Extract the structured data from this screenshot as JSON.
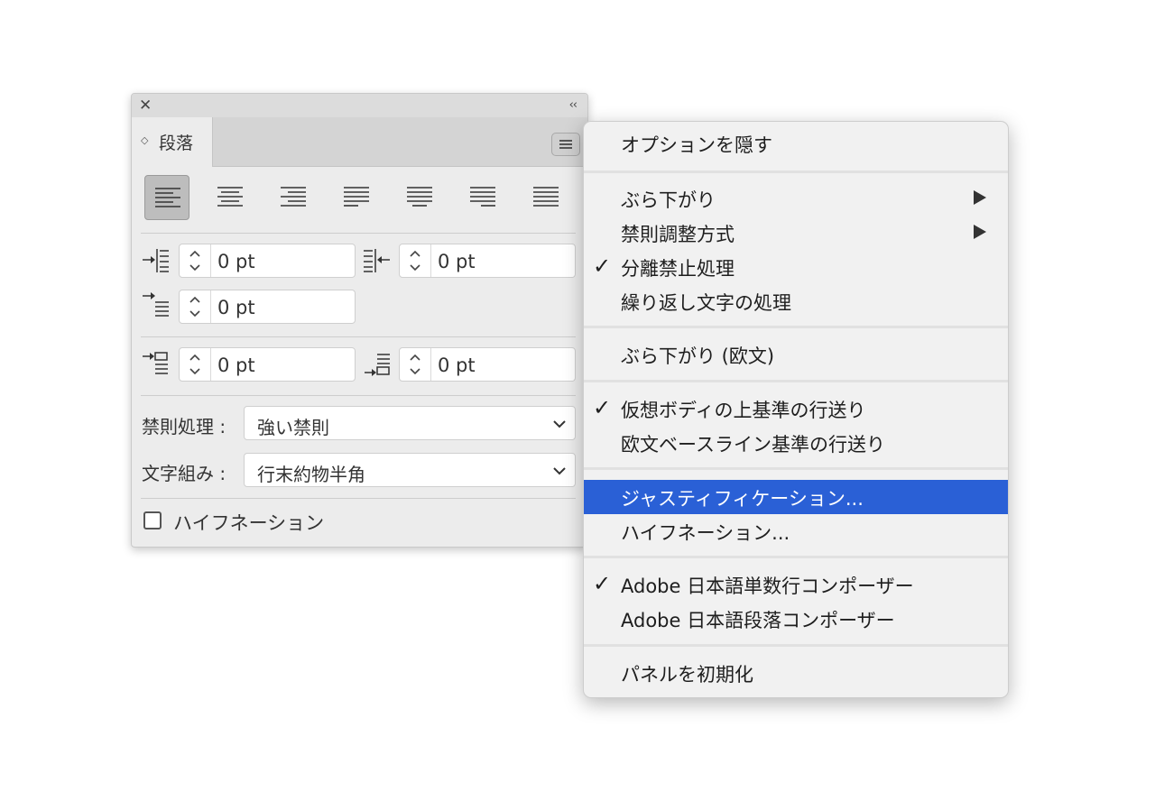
{
  "panel": {
    "close_glyph": "✕",
    "collapse_glyph": "‹‹",
    "tab_arrows": "◇",
    "tab_label": "段落",
    "left_indent": "0 pt",
    "right_indent": "0 pt",
    "first_line_indent": "0 pt",
    "space_before": "0 pt",
    "space_after": "0 pt",
    "kinsoku_label": "禁則処理 :",
    "kinsoku_value": "強い禁則",
    "mojikumi_label": "文字組み :",
    "mojikumi_value": "行末約物半角",
    "hyphenation_label": "ハイフネーション",
    "hyphenation_checked": false,
    "alignment_options": [
      "align-left",
      "align-center",
      "align-right",
      "justify-left",
      "justify-center",
      "justify-right",
      "justify-all"
    ],
    "active_alignment": "align-left"
  },
  "menu": {
    "items": [
      {
        "label": "オプションを隠す",
        "checked": false,
        "submenu": false
      },
      {
        "label": "ぶら下がり",
        "checked": false,
        "submenu": true
      },
      {
        "label": "禁則調整方式",
        "checked": false,
        "submenu": true
      },
      {
        "label": "分離禁止処理",
        "checked": true,
        "submenu": false
      },
      {
        "label": "繰り返し文字の処理",
        "checked": false,
        "submenu": false
      },
      {
        "label": "ぶら下がり (欧文)",
        "checked": false,
        "submenu": false
      },
      {
        "label": "仮想ボディの上基準の行送り",
        "checked": true,
        "submenu": false
      },
      {
        "label": "欧文ベースライン基準の行送り",
        "checked": false,
        "submenu": false
      },
      {
        "label": "ジャスティフィケーション...",
        "checked": false,
        "submenu": false,
        "highlighted": true
      },
      {
        "label": "ハイフネーション...",
        "checked": false,
        "submenu": false
      },
      {
        "label": "Adobe 日本語単数行コンポーザー",
        "checked": true,
        "submenu": false
      },
      {
        "label": "Adobe 日本語段落コンポーザー",
        "checked": false,
        "submenu": false
      },
      {
        "label": "パネルを初期化",
        "checked": false,
        "submenu": false
      }
    ],
    "check_glyph": "✓",
    "highlight_color": "#2a60d6"
  }
}
